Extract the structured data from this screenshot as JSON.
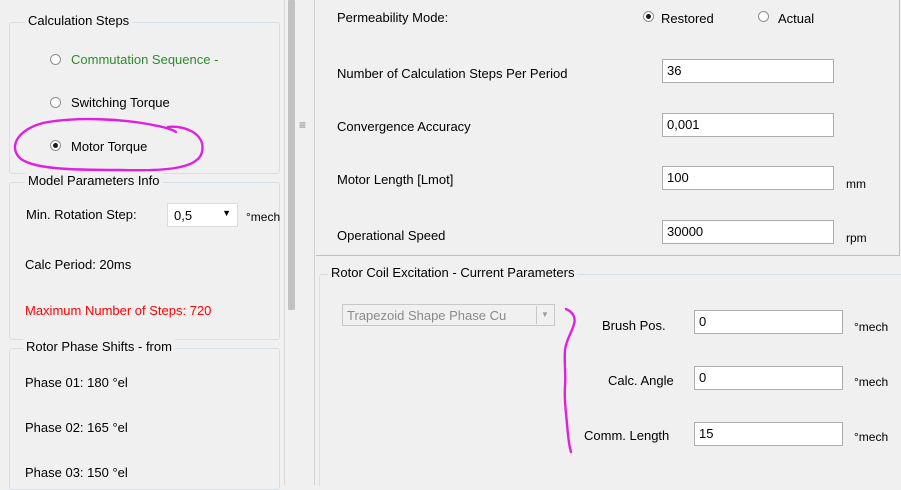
{
  "left": {
    "calc_steps": {
      "title": "Calculation Steps",
      "options": [
        {
          "label": "Commutation Sequence -",
          "selected": false
        },
        {
          "label": "Switching Torque",
          "selected": false
        },
        {
          "label": "Motor Torque",
          "selected": true
        }
      ]
    },
    "model_params": {
      "title": "Model Parameters Info",
      "min_rotation_label": "Min. Rotation Step:",
      "min_rotation_value": "0,5",
      "min_rotation_unit": "°mech",
      "calc_period": "Calc Period: 20ms",
      "max_steps": "Maximum Number of Steps: 720"
    },
    "phase_shifts": {
      "title": "Rotor Phase Shifts - from",
      "phases": [
        "Phase 01: 180 °el",
        "Phase 02: 165 °el",
        "Phase 03: 150 °el"
      ]
    }
  },
  "splitter": {
    "grip": "≡"
  },
  "right": {
    "permeability": {
      "label": "Permeability Mode:",
      "options": [
        {
          "label": "Restored",
          "selected": true
        },
        {
          "label": "Actual",
          "selected": false
        }
      ]
    },
    "fields": [
      {
        "label": "Number of Calculation Steps Per Period",
        "value": "36",
        "unit": ""
      },
      {
        "label": "Convergence Accuracy",
        "value": "0,001",
        "unit": ""
      },
      {
        "label": "Motor Length [Lmot]",
        "value": "100",
        "unit": "mm"
      },
      {
        "label": "Operational Speed",
        "value": "30000",
        "unit": "rpm"
      }
    ],
    "rotor_coil": {
      "title": "Rotor Coil Excitation - Current Parameters",
      "shape_select": "Trapezoid Shape Phase Cu",
      "brush_pos": {
        "label": "Brush Pos.",
        "value": "0",
        "unit": "°mech"
      },
      "calc_angle": {
        "label": "Calc. Angle",
        "value": "0",
        "unit": "°mech"
      },
      "comm_length": {
        "label": "Comm. Length",
        "value": "15",
        "unit": "°mech"
      }
    }
  },
  "colors": {
    "annotation": "#e020e0",
    "green_text": "#2e8b2e",
    "red_text": "#ff0000"
  }
}
